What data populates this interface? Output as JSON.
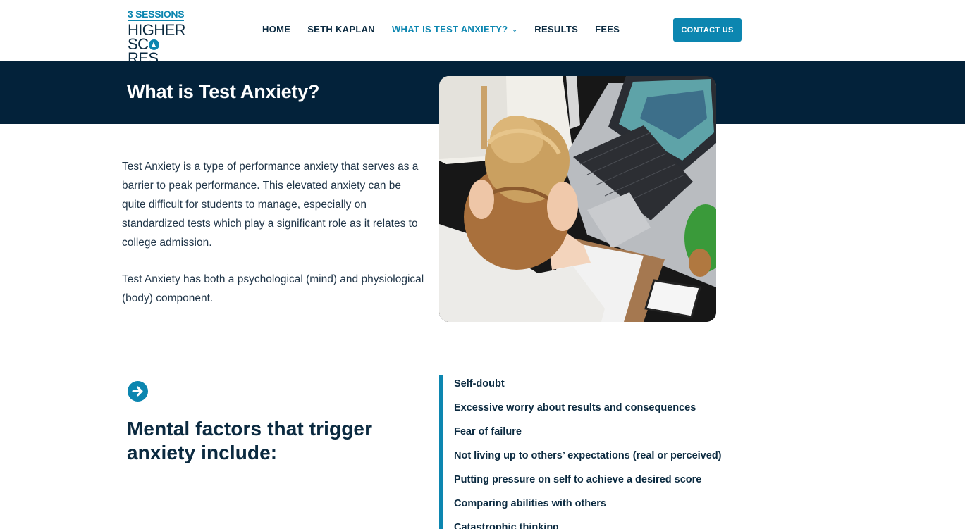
{
  "logo": {
    "line1": "3 SESSIONS",
    "line2": "HIGHER",
    "line3_pre": "SC",
    "line3_post": "RES"
  },
  "nav": {
    "items": [
      {
        "label": "HOME"
      },
      {
        "label": "SETH KAPLAN"
      },
      {
        "label": "WHAT IS TEST ANXIETY?",
        "active": true
      },
      {
        "label": "RESULTS"
      },
      {
        "label": "FEES"
      }
    ],
    "contact_label": "CONTACT US"
  },
  "hero": {
    "title": "What is Test Anxiety?"
  },
  "intro": {
    "p1": "Test Anxiety is a type of performance anxiety that serves as a barrier to peak performance. This elevated anxiety can be quite difficult for students to manage, especially on standardized tests which play a significant role as it relates to college admission.",
    "p2": "Test Anxiety has both a psychological (mind) and physiological (body) component."
  },
  "mental": {
    "title": "Mental factors that trigger anxiety include:",
    "icon": "arrow-right-circle-icon",
    "factors": [
      "Self-doubt",
      "Excessive worry about results and consequences",
      "Fear of failure",
      "Not living up to others’ expectations (real or perceived)",
      "Putting pressure on self to achieve a desired score",
      "Comparing abilities with others",
      "Catastrophic thinking"
    ]
  },
  "colors": {
    "accent": "#0c86b0",
    "navy": "#03223a",
    "text": "#0b2a40"
  }
}
